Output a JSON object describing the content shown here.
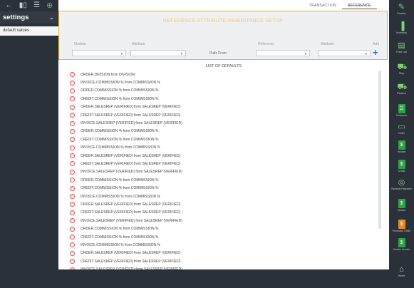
{
  "left_nav": {
    "title": "settings",
    "items": [
      "default values"
    ]
  },
  "tabs": [
    "TRANSACTION",
    "REFERENCE"
  ],
  "setup": {
    "title": "REFERENCE ATTRIBUTE INHERITANCE SETUP",
    "module_label": "Module",
    "attribute_label": "Attribute",
    "pulls_from": "Pulls From",
    "reference_label": "Reference",
    "attribute2_label": "Attribute",
    "add_label": "Add"
  },
  "list_title": "LIST OF DEFAULTS",
  "defaults": [
    "ORDER.DIVISION from DIVISION",
    "INVOICE.COMMISSION % from COMMISSION %",
    "ORDER.COMMISSION % from COMMISSION %",
    "CREDIT.COMMISSION % from COMMISSION %",
    "ORDER.SALESREP (VERIFIED) from SALESREP (VERIFIED)",
    "CREDIT.SALESREP (VERIFIED) from SALESREP (VERIFIED)",
    "INVOICE.SALESREP (VERIFIED) from SALESREP (VERIFIED)",
    "ORDER.COMMISSION % from COMMISSION %",
    "CREDIT.COMMISSION % from COMMISSION %",
    "INVOICE.COMMISSION % from COMMISSION %",
    "ORDER.SALESREP (VERIFIED) from SALESREP (VERIFIED)",
    "CREDIT.SALESREP (VERIFIED) from SALESREP (VERIFIED)",
    "INVOICE.SALESREP (VERIFIED) from SALESREP (VERIFIED)",
    "ORDER.COMMISSION % from COMMISSION %",
    "CREDIT.COMMISSION % from COMMISSION %",
    "INVOICE.COMMISSION % from COMMISSION %",
    "ORDER.SALESREP (VERIFIED) from SALESREP (VERIFIED)",
    "CREDIT.SALESREP (VERIFIED) from SALESREP (VERIFIED)",
    "INVOICE.SALESREP (VERIFIED) from SALESREP (VERIFIED)",
    "ORDER.COMMISSION % from COMMISSION %",
    "CREDIT.COMMISSION % from COMMISSION %",
    "INVOICE.COMMISSION % from COMMISSION %",
    "ORDER.SALESREP (VERIFIED) from SALESREP (VERIFIED)",
    "CREDIT.SALESREP (VERIFIED) from SALESREP (VERIFIED)",
    "INVOICE.SALESREP (VERIFIED) from SALESREP (VERIFIED)"
  ],
  "rail": [
    {
      "label": "Product",
      "icon": "tag-icon"
    },
    {
      "label": "Inventory",
      "icon": "barcode-icon"
    },
    {
      "label": "Price List",
      "icon": "price-list-icon"
    },
    {
      "label": "Ship",
      "icon": "truck-icon"
    },
    {
      "label": "Receive",
      "icon": "receive-truck-icon"
    },
    {
      "label": "Customer",
      "icon": "customer-icon"
    },
    {
      "label": "Order",
      "icon": "order-icon"
    },
    {
      "label": "Invoice",
      "icon": "invoice-icon"
    },
    {
      "label": "Credit",
      "icon": "credit-icon"
    },
    {
      "label": "Receive Payment",
      "icon": "payment-icon"
    },
    {
      "label": "Vendor",
      "icon": "vendor-icon"
    },
    {
      "label": "Purchase Order",
      "icon": "purchase-order-icon"
    },
    {
      "label": "Vendor Invoice",
      "icon": "vendor-invoice-icon"
    },
    {
      "label": "Home",
      "icon": "home-icon"
    }
  ]
}
